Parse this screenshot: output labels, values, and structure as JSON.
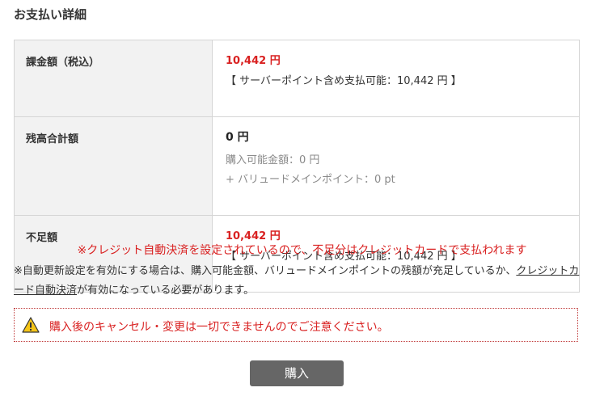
{
  "page_title": "お支払い詳細",
  "rows": [
    {
      "label": "課金額（税込）",
      "amount": "10,442 円",
      "sub": "【 サーバーポイント含め支払可能：10,442 円 】"
    },
    {
      "label": "残高合計額",
      "amount": "0 円",
      "details": [
        "購入可能金額：0 円",
        "+ バリュードメインポイント：0 pt"
      ]
    },
    {
      "label": "不足額",
      "amount": "10,442 円",
      "sub": "【 サーバーポイント含め支払可能：10,442 円 】"
    }
  ],
  "notice_red": "※クレジット自動決済を設定されているので、不足分はクレジットカードで支払われます",
  "note": {
    "before": "※自動更新設定を有効にする場合は、購入可能金額、バリュードメインポイントの残額が充足しているか、",
    "link": "クレジットカード自動決済",
    "after": "が有効になっている必要があります。"
  },
  "warning": {
    "icon": "warning-icon",
    "text": "購入後のキャンセル・変更は一切できませんのでご注意ください。"
  },
  "buy_button": "購入",
  "colors": {
    "accent_red": "#d92121",
    "label_bg": "#f2f2f2",
    "button_bg": "#666666",
    "warning_yellow": "#f5c518"
  }
}
